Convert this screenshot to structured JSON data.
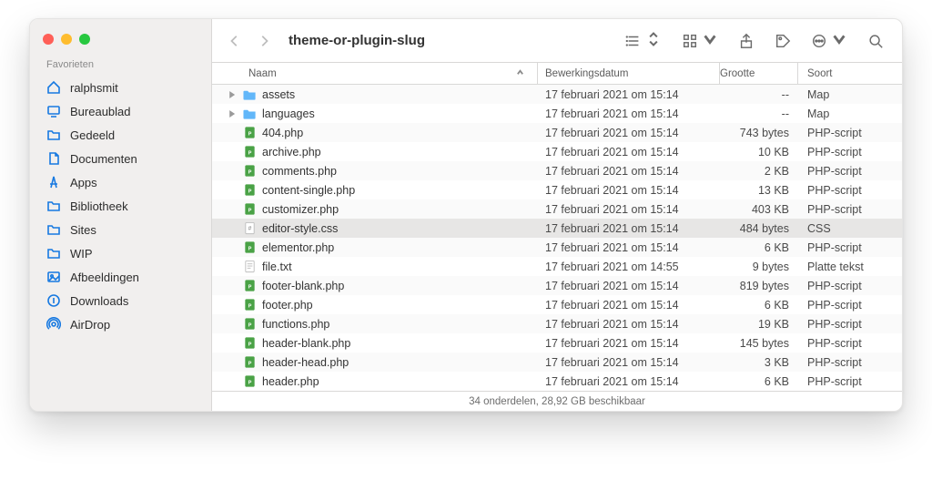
{
  "window_title": "theme-or-plugin-slug",
  "sidebar": {
    "section_label": "Favorieten",
    "items": [
      {
        "label": "ralphsmit",
        "icon": "home"
      },
      {
        "label": "Bureaublad",
        "icon": "desktop"
      },
      {
        "label": "Gedeeld",
        "icon": "folder"
      },
      {
        "label": "Documenten",
        "icon": "document"
      },
      {
        "label": "Apps",
        "icon": "apps"
      },
      {
        "label": "Bibliotheek",
        "icon": "folder"
      },
      {
        "label": "Sites",
        "icon": "folder"
      },
      {
        "label": "WIP",
        "icon": "folder"
      },
      {
        "label": "Afbeeldingen",
        "icon": "image"
      },
      {
        "label": "Downloads",
        "icon": "download"
      },
      {
        "label": "AirDrop",
        "icon": "airdrop"
      }
    ]
  },
  "columns": {
    "name": "Naam",
    "date": "Bewerkingsdatum",
    "size": "Grootte",
    "kind": "Soort"
  },
  "files": [
    {
      "expandable": true,
      "icon": "folder",
      "name": "assets",
      "date": "17 februari 2021 om 15:14",
      "size": "--",
      "kind": "Map"
    },
    {
      "expandable": true,
      "icon": "folder",
      "name": "languages",
      "date": "17 februari 2021 om 15:14",
      "size": "--",
      "kind": "Map"
    },
    {
      "expandable": false,
      "icon": "php",
      "name": "404.php",
      "date": "17 februari 2021 om 15:14",
      "size": "743 bytes",
      "kind": "PHP-script"
    },
    {
      "expandable": false,
      "icon": "php",
      "name": "archive.php",
      "date": "17 februari 2021 om 15:14",
      "size": "10 KB",
      "kind": "PHP-script"
    },
    {
      "expandable": false,
      "icon": "php",
      "name": "comments.php",
      "date": "17 februari 2021 om 15:14",
      "size": "2 KB",
      "kind": "PHP-script"
    },
    {
      "expandable": false,
      "icon": "php",
      "name": "content-single.php",
      "date": "17 februari 2021 om 15:14",
      "size": "13 KB",
      "kind": "PHP-script"
    },
    {
      "expandable": false,
      "icon": "php",
      "name": "customizer.php",
      "date": "17 februari 2021 om 15:14",
      "size": "403 KB",
      "kind": "PHP-script"
    },
    {
      "expandable": false,
      "icon": "css",
      "name": "editor-style.css",
      "date": "17 februari 2021 om 15:14",
      "size": "484 bytes",
      "kind": "CSS",
      "selected": true
    },
    {
      "expandable": false,
      "icon": "php",
      "name": "elementor.php",
      "date": "17 februari 2021 om 15:14",
      "size": "6 KB",
      "kind": "PHP-script"
    },
    {
      "expandable": false,
      "icon": "txt",
      "name": "file.txt",
      "date": "17 februari 2021 om 14:55",
      "size": "9 bytes",
      "kind": "Platte tekst"
    },
    {
      "expandable": false,
      "icon": "php",
      "name": "footer-blank.php",
      "date": "17 februari 2021 om 15:14",
      "size": "819 bytes",
      "kind": "PHP-script"
    },
    {
      "expandable": false,
      "icon": "php",
      "name": "footer.php",
      "date": "17 februari 2021 om 15:14",
      "size": "6 KB",
      "kind": "PHP-script"
    },
    {
      "expandable": false,
      "icon": "php",
      "name": "functions.php",
      "date": "17 februari 2021 om 15:14",
      "size": "19 KB",
      "kind": "PHP-script"
    },
    {
      "expandable": false,
      "icon": "php",
      "name": "header-blank.php",
      "date": "17 februari 2021 om 15:14",
      "size": "145 bytes",
      "kind": "PHP-script"
    },
    {
      "expandable": false,
      "icon": "php",
      "name": "header-head.php",
      "date": "17 februari 2021 om 15:14",
      "size": "3 KB",
      "kind": "PHP-script"
    },
    {
      "expandable": false,
      "icon": "php",
      "name": "header.php",
      "date": "17 februari 2021 om 15:14",
      "size": "6 KB",
      "kind": "PHP-script"
    }
  ],
  "status_bar": "34 onderdelen, 28,92 GB beschikbaar"
}
